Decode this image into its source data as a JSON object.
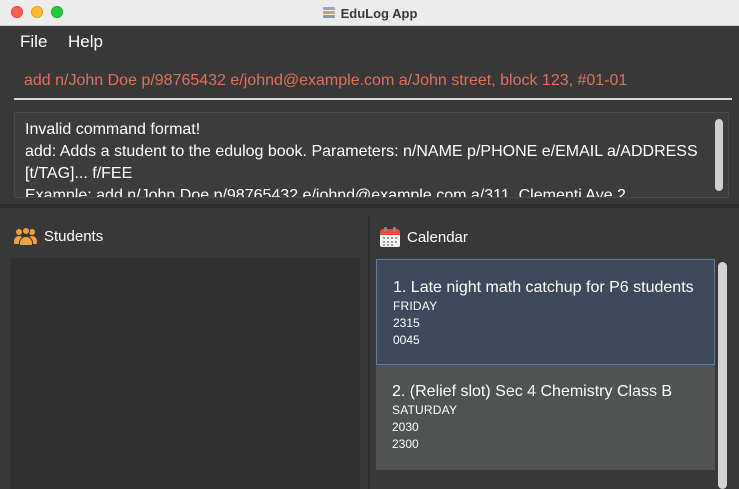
{
  "window": {
    "title": "EduLog App"
  },
  "menu": {
    "file": "File",
    "help": "Help"
  },
  "command": {
    "value": "add n/John Doe p/98765432 e/johnd@example.com a/John street, block 123, #01-01"
  },
  "result": {
    "lines": [
      "Invalid command format!",
      "add: Adds a student to the edulog book. Parameters: n/NAME p/PHONE e/EMAIL a/ADDRESS",
      "[t/TAG]... f/FEE",
      "Example: add n/John Doe p/98765432 e/johnd@example.com a/311, Clementi Ave 2"
    ]
  },
  "students_panel": {
    "title": "Students",
    "icon": "people-icon"
  },
  "calendar_panel": {
    "title": "Calendar",
    "icon": "calendar-icon",
    "events": [
      {
        "title": "1. Late night math catchup for P6 students",
        "day": "FRIDAY",
        "start": "2315",
        "end": "0045"
      },
      {
        "title": "2. (Relief slot) Sec 4 Chemistry Class B",
        "day": "SATURDAY",
        "start": "2030",
        "end": "2300"
      }
    ]
  },
  "colors": {
    "command_text": "#e0705c",
    "selected_card": "#3e4a5c",
    "selected_border": "#5c7ea8",
    "normal_card": "#4f5352",
    "students_icon": "#f0a23a",
    "calendar_icon": "#e94b3c"
  }
}
